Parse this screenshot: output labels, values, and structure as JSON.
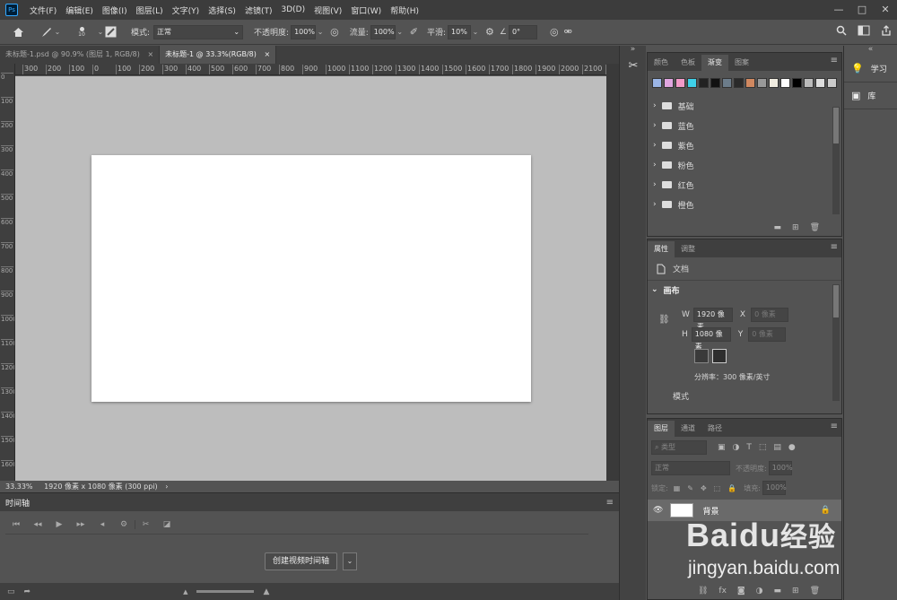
{
  "menubar": {
    "logo": "Ps",
    "items": [
      "文件(F)",
      "编辑(E)",
      "图像(I)",
      "图层(L)",
      "文字(Y)",
      "选择(S)",
      "滤镜(T)",
      "3D(D)",
      "视图(V)",
      "窗口(W)",
      "帮助(H)"
    ],
    "window_controls": {
      "minimize": "—",
      "maximize": "□",
      "close": "✕"
    }
  },
  "options": {
    "brush_size": "10",
    "mode_label": "模式:",
    "mode_value": "正常",
    "opacity_label": "不透明度:",
    "opacity_value": "100%",
    "flow_label": "流量:",
    "flow_value": "100%",
    "smooth_label": "平滑:",
    "smooth_value": "10%",
    "angle_value": "0°"
  },
  "tabs": [
    {
      "label": "未标题-1.psd @ 90.9% (图层 1, RGB/8)",
      "close": "×"
    },
    {
      "label": "未标题-1 @ 33.3%(RGB/8)",
      "close": "×"
    }
  ],
  "ruler": {
    "h": [
      "300",
      "200",
      "100",
      "0",
      "100",
      "200",
      "300",
      "400",
      "500",
      "600",
      "700",
      "800",
      "900",
      "1000",
      "1100",
      "1200",
      "1300",
      "1400",
      "1500",
      "1600",
      "1700",
      "1800",
      "1900",
      "2000",
      "2100",
      "2200"
    ],
    "v": [
      "0",
      "100",
      "200",
      "300",
      "400",
      "500",
      "600",
      "700",
      "800",
      "900",
      "1000",
      "1100",
      "1200",
      "1300",
      "1400",
      "1500",
      "1600"
    ]
  },
  "status": {
    "zoom": "33.33%",
    "info": "1920 像素 x 1080 像素 (300 ppi)",
    "arrow": "›"
  },
  "timeline": {
    "title": "时间轴",
    "create_button": "创建视频时间轴"
  },
  "swatches_panel": {
    "tabs": [
      "颜色",
      "色板",
      "渐变",
      "图案"
    ],
    "active_tab": "渐变",
    "gradient_colors": [
      "#9bb5e6",
      "#e0a6e0",
      "#f29ac8",
      "#3fd0e8",
      "#222222",
      "#111111",
      "#6c7c8a",
      "#2a2a2a",
      "#d08860",
      "#999999",
      "#f0ece0",
      "#ffffff",
      "#000000",
      "#bbbbbb",
      "#dddddd",
      "#cccccc"
    ],
    "groups": [
      "基础",
      "蓝色",
      "紫色",
      "粉色",
      "红色",
      "橙色"
    ]
  },
  "properties_panel": {
    "tabs": [
      "属性",
      "调整"
    ],
    "doc_label": "文档",
    "section": "画布",
    "w_label": "W",
    "w_value": "1920 像素",
    "h_label": "H",
    "h_value": "1080 像素",
    "x_label": "X",
    "x_placeholder": "0 像素",
    "y_label": "Y",
    "y_placeholder": "0 像素",
    "resolution": "分辨率：300 像素/英寸",
    "mode_label": "模式"
  },
  "layers_panel": {
    "tabs": [
      "图层",
      "通道",
      "路径"
    ],
    "filter_placeholder": "类型",
    "blend_mode": "正常",
    "opacity_label": "不透明度:",
    "opacity_value": "100%",
    "lock_label": "锁定:",
    "fill_label": "填充:",
    "fill_value": "100%",
    "layer_name": "背景"
  },
  "dock": {
    "learn": "学习",
    "library": "库"
  },
  "watermark": {
    "brand": "Baidu",
    "brand_cn": "经验",
    "url": "jingyan.baidu.com"
  }
}
